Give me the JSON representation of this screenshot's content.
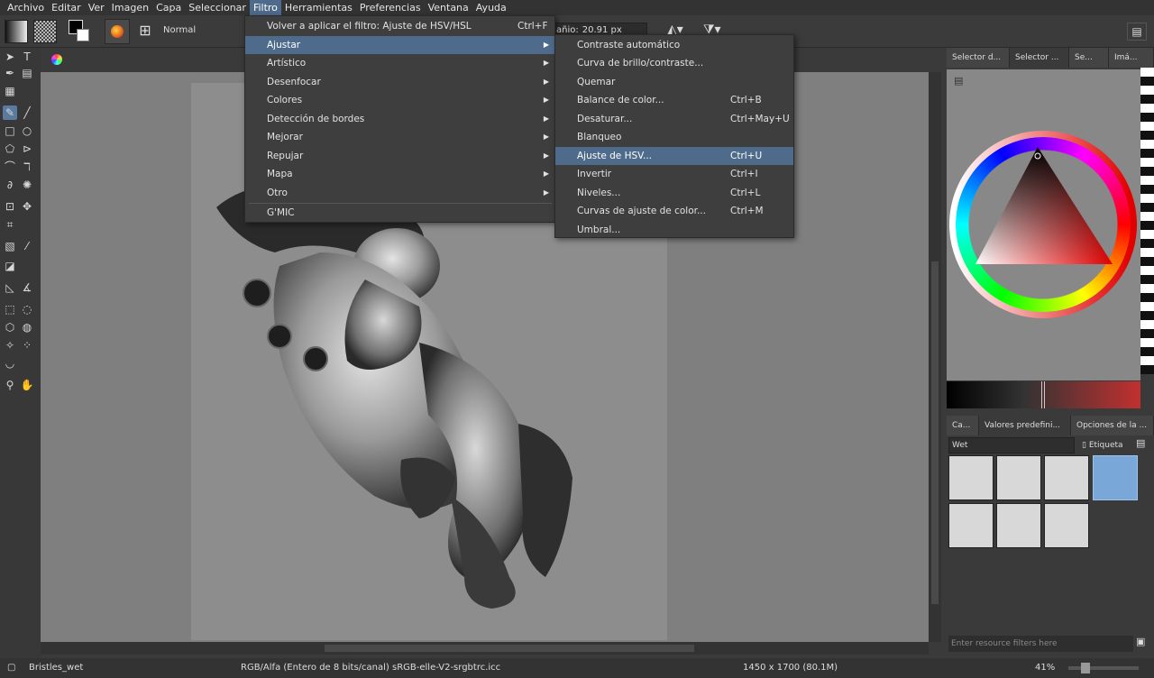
{
  "menubar": [
    "Archivo",
    "Editar",
    "Ver",
    "Imagen",
    "Capa",
    "Seleccionar",
    "Filtro",
    "Herramientas",
    "Preferencias",
    "Ventana",
    "Ayuda"
  ],
  "toolbar": {
    "blend_mode": "Normal",
    "size_label": "añio:",
    "size_value": "20.91 px"
  },
  "filter_menu": {
    "reapply": {
      "label": "Volver a aplicar el filtro: Ajuste de HSV/HSL",
      "shortcut": "Ctrl+F"
    },
    "items": [
      "Ajustar",
      "Artístico",
      "Desenfocar",
      "Colores",
      "Detección de bordes",
      "Mejorar",
      "Repujar",
      "Mapa",
      "Otro"
    ],
    "gmic": "G'MIC"
  },
  "adjust_menu": {
    "items": [
      {
        "label": "Contraste automático",
        "shortcut": ""
      },
      {
        "label": "Curva de brillo/contraste...",
        "shortcut": ""
      },
      {
        "label": "Quemar",
        "shortcut": ""
      },
      {
        "label": "Balance de color...",
        "shortcut": "Ctrl+B"
      },
      {
        "label": "Desaturar...",
        "shortcut": "Ctrl+May+U"
      },
      {
        "label": "Blanqueo",
        "shortcut": ""
      },
      {
        "label": "Ajuste de HSV...",
        "shortcut": "Ctrl+U"
      },
      {
        "label": "Invertir",
        "shortcut": "Ctrl+I"
      },
      {
        "label": "Niveles...",
        "shortcut": "Ctrl+L"
      },
      {
        "label": "Curvas de ajuste de color...",
        "shortcut": "Ctrl+M"
      },
      {
        "label": "Umbral...",
        "shortcut": ""
      }
    ]
  },
  "dock": {
    "top_tabs": [
      "Selector d...",
      "Selector ...",
      "Se...",
      "Imá..."
    ],
    "bottom_tabs": [
      "Ca...",
      "Valores predefini...",
      "Opciones de la ..."
    ],
    "preset_filter": "Wet",
    "tag_label": "Etiqueta",
    "resource_filter_placeholder": "Enter resource filters here"
  },
  "status": {
    "brush": "Bristles_wet",
    "color_model": "RGB/Alfa (Entero de 8 bits/canal)  sRGB-elle-V2-srgbtrc.icc",
    "dimensions": "1450 x 1700 (80.1M)",
    "zoom": "41%"
  },
  "colors": {
    "menu_highlight": "#4f6b8c",
    "canvas_bg": "#7f7f7f"
  }
}
